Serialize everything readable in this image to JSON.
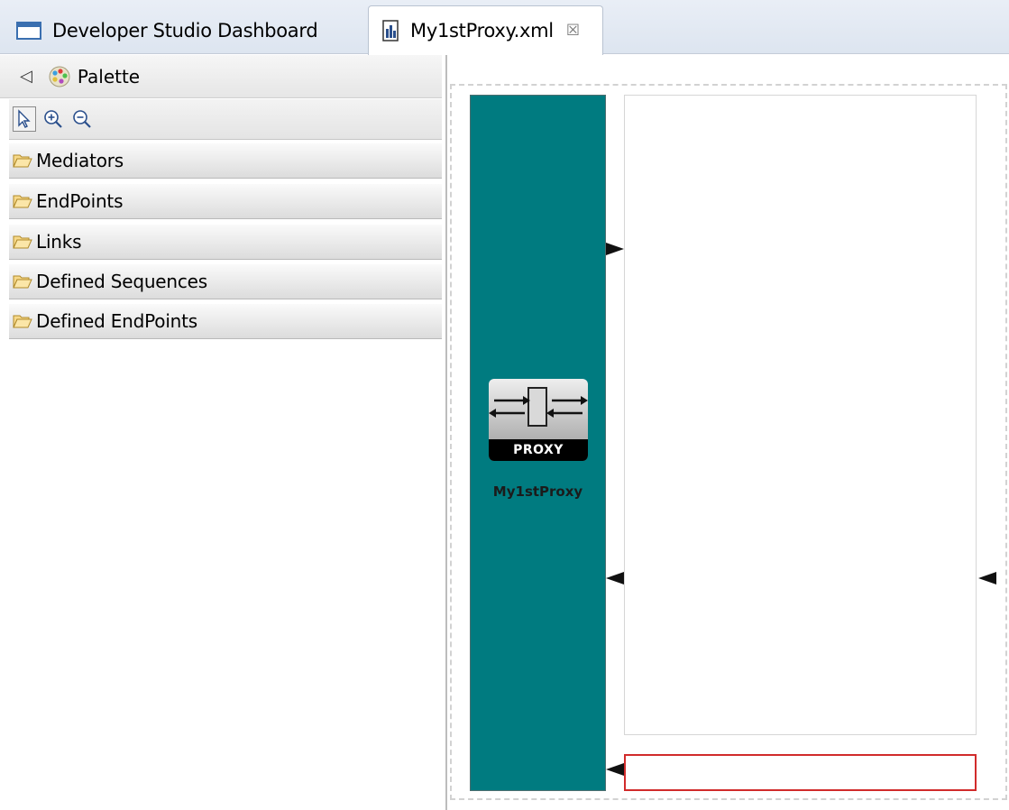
{
  "tabs": [
    {
      "label": "Developer Studio Dashboard",
      "icon": "window-icon",
      "active": false
    },
    {
      "label": "My1stProxy.xml",
      "icon": "xml-file-icon",
      "active": true,
      "close": "☒"
    }
  ],
  "palette": {
    "title": "Palette",
    "collapse_glyph": "◁",
    "tools": [
      "select-tool",
      "zoom-in-tool",
      "zoom-out-tool"
    ],
    "drawers": [
      "Mediators",
      "EndPoints",
      "Links",
      "Defined Sequences",
      "Defined EndPoints"
    ]
  },
  "canvas": {
    "proxy_badge": "PROXY",
    "proxy_name": "My1stProxy"
  },
  "colors": {
    "proxy_fill": "#007b80",
    "fault_border": "#d12b2b",
    "tabbar": "#dde5f0"
  }
}
